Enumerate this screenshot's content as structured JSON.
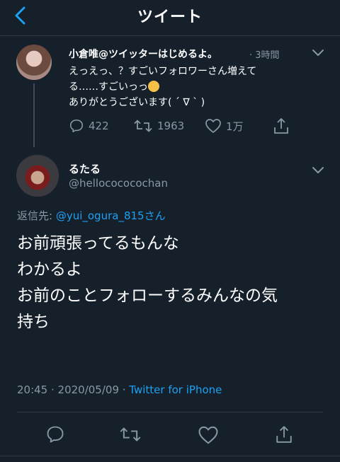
{
  "header": {
    "title": "ツイート"
  },
  "tweet1": {
    "name": "小倉唯@ツイッターはじめるよ。",
    "time": "· 3時間",
    "line1": "えっえっ、？すごいフォロワーさん増えて",
    "line2": "る……すごいっっ",
    "line3": "ありがとうございます( ´ ∇ ` )",
    "replies": "422",
    "retweets": "1963",
    "likes": "1万"
  },
  "tweet2": {
    "name": "るたる",
    "handle": "@hellocococochan",
    "reply_prefix": "返信先: ",
    "reply_mention": "@yui_ogura_815",
    "reply_suffix": "さん",
    "text_lines": [
      "お前頑張ってるもんな",
      "わかるよ",
      "お前のことフォローするみんなの気",
      "持ち"
    ],
    "timestamp": "20:45 · 2020/05/09 · ",
    "source": "Twitter for iPhone"
  },
  "colors": {
    "background": "#15202b",
    "accent": "#1da1f2",
    "muted": "#8899a6",
    "divider": "#2f3b47"
  },
  "icons": [
    "back-chevron-icon",
    "chevron-down-icon",
    "reply-icon",
    "retweet-icon",
    "like-icon",
    "share-icon",
    "emoji-flushed-icon"
  ]
}
